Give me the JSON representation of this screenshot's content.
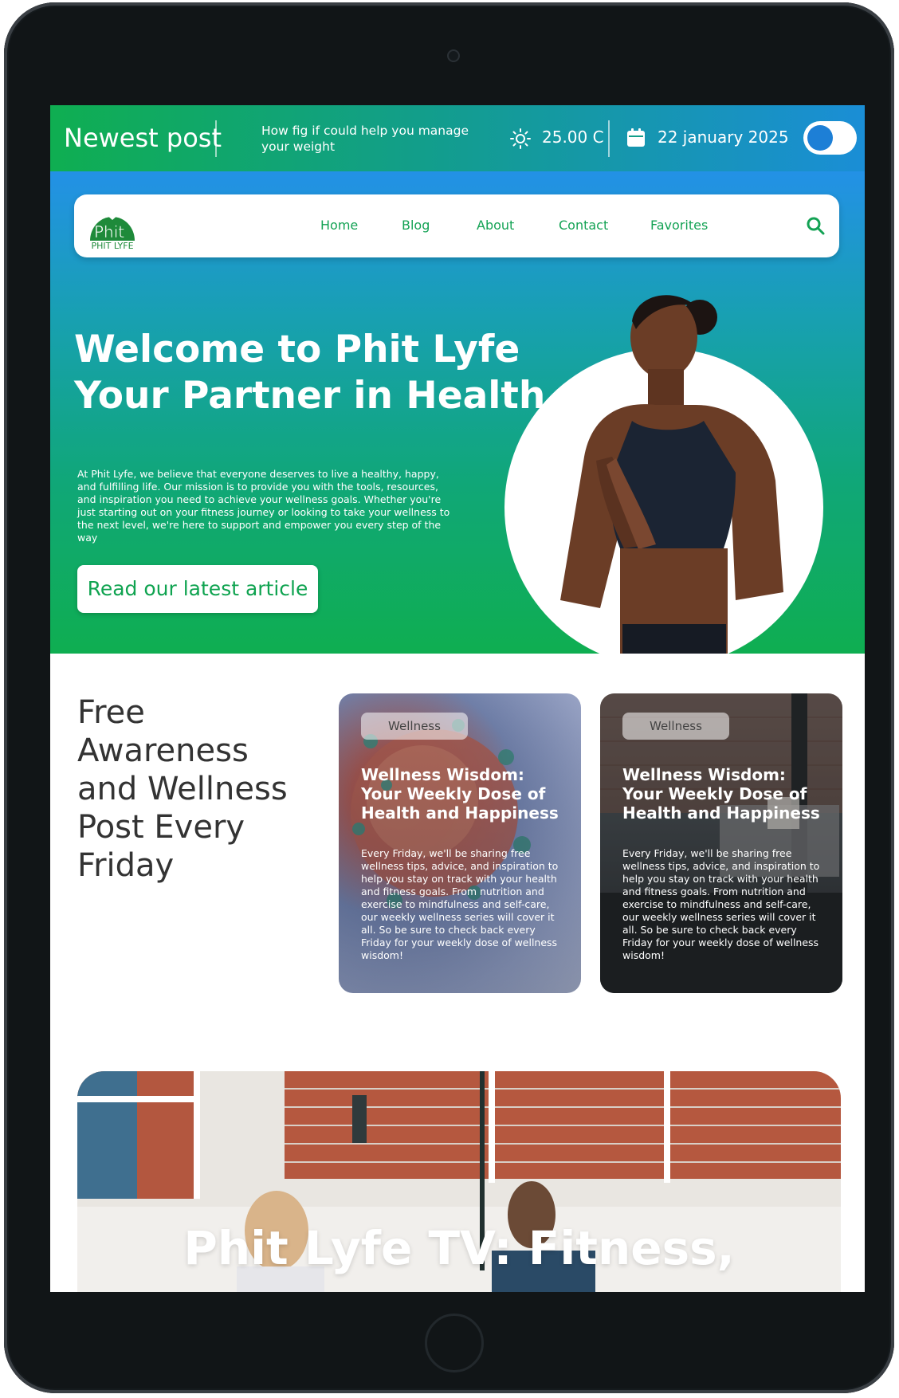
{
  "topbar": {
    "title": "Newest post",
    "post_title": "How fig if could help you manage your weight",
    "temperature": "25.00 C",
    "date": "22 january 2025",
    "theme_toggle_on": true
  },
  "nav": {
    "logo_text": "PHIT LYFE",
    "items": [
      "Home",
      "Blog",
      "About",
      "Contact",
      "Favorites"
    ]
  },
  "hero": {
    "title_line1": "Welcome to Phit Lyfe",
    "title_line2": "Your Partner in Health",
    "description": "At Phit Lyfe, we believe that everyone deserves to live a healthy, happy, and fulfilling life. Our mission is to provide you with the tools, resources, and inspiration you need to achieve your wellness goals. Whether you're just starting out on your fitness journey or looking to take your wellness to the next level, we're here to support and empower you every step of the way",
    "cta": "Read our latest article"
  },
  "wellness": {
    "heading": "Free Awareness and Wellness Post Every Friday",
    "cards": [
      {
        "badge": "Wellness",
        "title": "Wellness Wisdom: Your Weekly Dose of Health and Happiness",
        "body": "Every Friday, we'll be sharing free wellness tips, advice, and inspiration to help you stay on track with your health and fitness goals. From nutrition and exercise to mindfulness and self-care, our weekly wellness series will cover it all. So be sure to check back every Friday for your weekly dose of wellness wisdom!"
      },
      {
        "badge": "Wellness",
        "title": "Wellness Wisdom: Your Weekly Dose of Health and Happiness",
        "body": "Every Friday, we'll be sharing free wellness tips, advice, and inspiration to help you stay on track with your health and fitness goals. From nutrition and exercise to mindfulness and self-care, our weekly wellness series will cover it all. So be sure to check back every Friday for your weekly dose of wellness wisdom!"
      }
    ]
  },
  "tv": {
    "title": "Phit Lyfe TV: Fitness,"
  },
  "colors": {
    "brand_green": "#0fae51",
    "brand_blue": "#1a8ed6",
    "nav_text": "#13a254"
  }
}
